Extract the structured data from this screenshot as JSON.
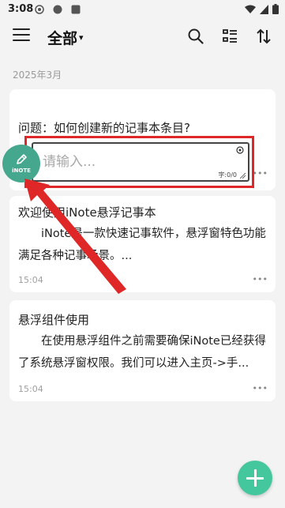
{
  "status": {
    "time": "3:08"
  },
  "header": {
    "title": "全部",
    "caret": "▾"
  },
  "section": {
    "date": "2025年3月"
  },
  "composer": {
    "question": "问题：如何创建新的记事本条目?",
    "placeholder": "请输入...",
    "char_count": "字:0/0"
  },
  "floating_ball": {
    "label": "iNOTE"
  },
  "notes": [
    {
      "title": "欢迎使用iNote悬浮记事本",
      "body": "iNote是一款快速记事软件，悬浮窗特色功能满足各种记事场景。...",
      "time": "15:04",
      "more": "•••"
    },
    {
      "title": "悬浮组件使用",
      "body": "在使用悬浮组件之前需要确保iNote已经获得了系统悬浮窗权限。我们可以进入主页->手...",
      "time": "15:04",
      "more": "•••"
    }
  ],
  "composer_more": "•••",
  "colors": {
    "accent": "#45c79e",
    "float_ball": "#45a88e",
    "annotation": "#e02727"
  }
}
